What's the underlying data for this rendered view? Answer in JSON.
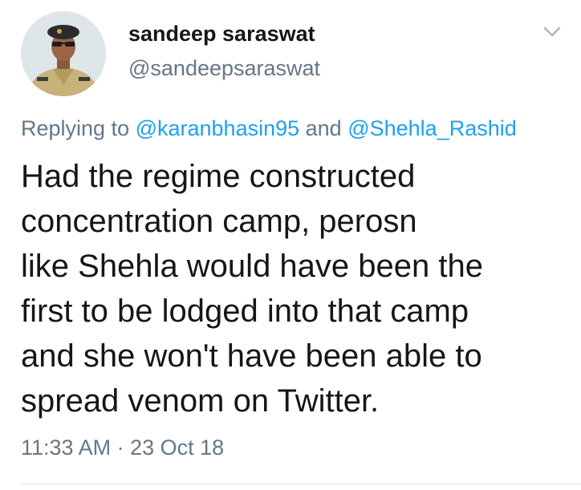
{
  "tweet": {
    "author": {
      "display_name": "sandeep saraswat",
      "handle": "@sandeepsaraswat",
      "avatar_icon": "user-avatar-photo"
    },
    "menu_icon": "chevron-down-icon",
    "reply": {
      "prefix": "Replying to ",
      "mentions": [
        "@karanbhasin95",
        "@Shehla_Rashid"
      ],
      "joiner": " and "
    },
    "text_lines": [
      "Had the regime constructed",
      "concentration camp, perosn",
      "like Shehla would have been the",
      "first to be lodged into that camp",
      "and she won't have been able to",
      "spread venom on Twitter."
    ],
    "timestamp": {
      "time": "11:33 AM",
      "separator": " · ",
      "date": "23 Oct 18"
    },
    "colors": {
      "text": "#14171a",
      "secondary": "#657786",
      "link": "#1da1f2",
      "divider": "#e1e8ed"
    }
  }
}
